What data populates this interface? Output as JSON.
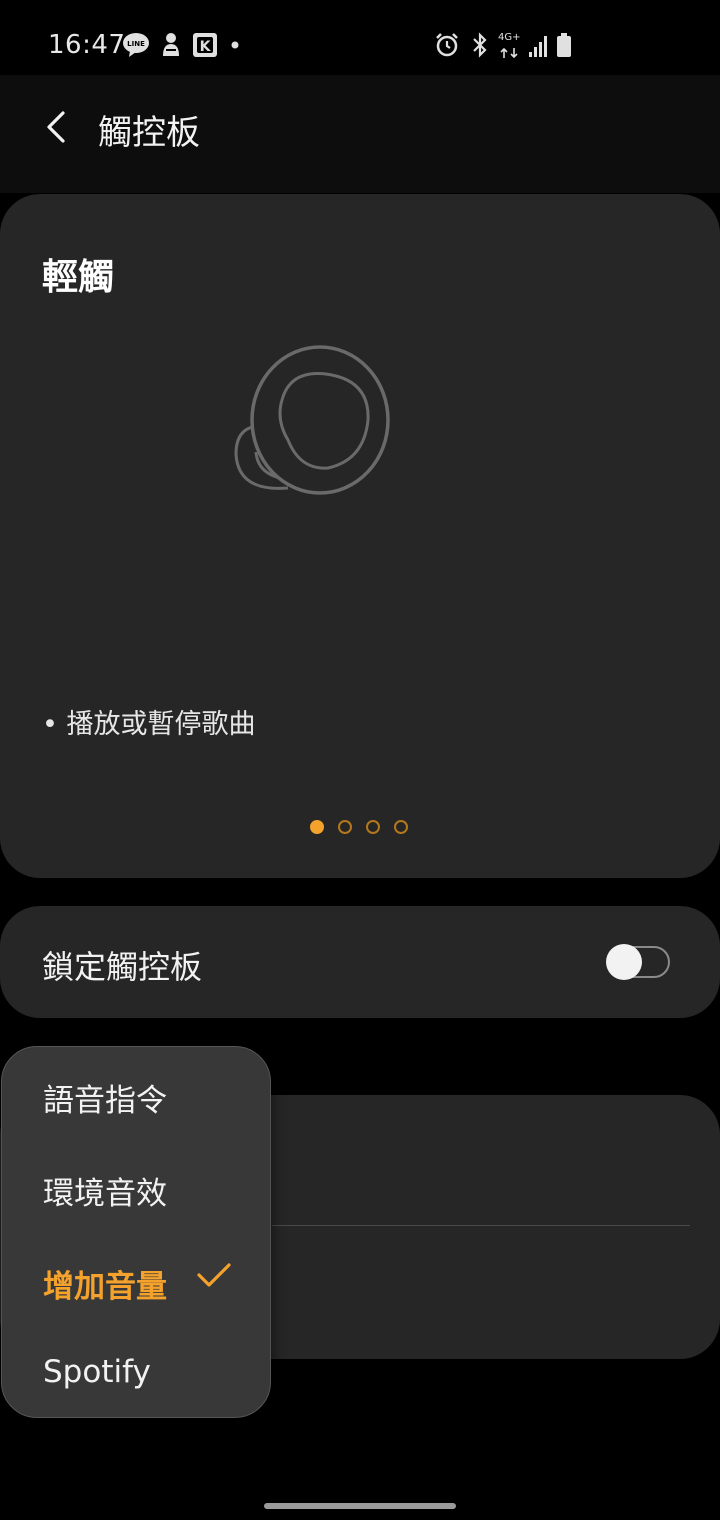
{
  "status_bar": {
    "time": "16:47",
    "left_icons": [
      "line-app-icon",
      "notification-app-icon",
      "k-app-icon",
      "more-dot-icon"
    ],
    "right_icons": [
      "alarm-icon",
      "bluetooth-icon",
      "network-4g-icon",
      "signal-icon",
      "battery-icon"
    ],
    "network_label": "4G+"
  },
  "app_bar": {
    "title": "觸控板",
    "back_icon": "chevron-left-icon"
  },
  "gesture_card": {
    "title": "輕觸",
    "description": "• 播放或暫停歌曲",
    "illustration": "earbud-icon",
    "pages_total": 4,
    "active_page": 1,
    "accent_color": "#f5a22c"
  },
  "lock_touchpad": {
    "label": "鎖定觸控板",
    "enabled": false
  },
  "popup_menu": {
    "items": [
      {
        "label": "語音指令",
        "selected": false
      },
      {
        "label": "環境音效",
        "selected": false
      },
      {
        "label": "增加音量",
        "selected": true
      },
      {
        "label": "Spotify",
        "selected": false
      }
    ],
    "selected_color": "#f5a22c"
  }
}
